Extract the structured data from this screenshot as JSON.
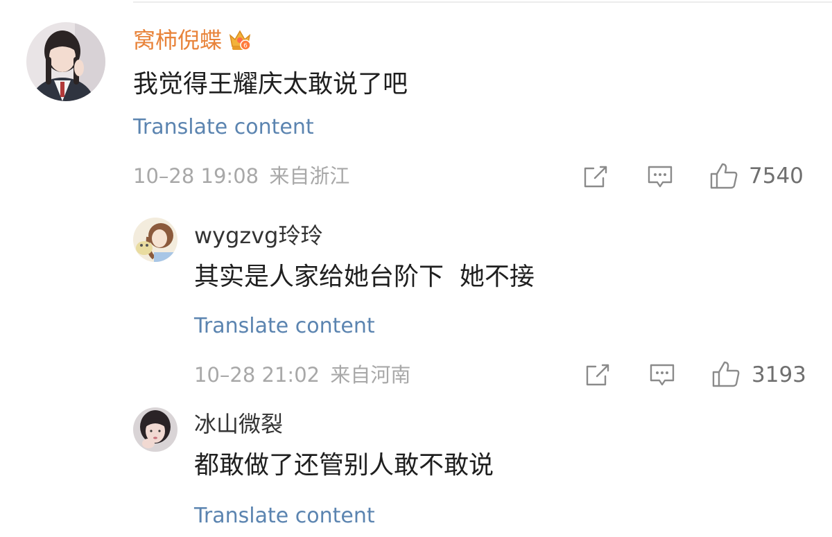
{
  "comments": [
    {
      "username": "窝柿倪蝶",
      "vip_badge_icon": "crown-badge-icon",
      "text": "我觉得王耀庆太敢说了吧",
      "translate_label": "Translate content",
      "timestamp": "10–28 19:08",
      "location": "来自浙江",
      "like_count": "7540"
    }
  ],
  "replies": [
    {
      "username": "wygzvg玲玲",
      "text": "其实是人家给她台阶下  她不接",
      "translate_label": "Translate content",
      "timestamp": "10–28 21:02",
      "location": "来自河南",
      "like_count": "3193"
    },
    {
      "username": "冰山微裂",
      "text": "都敢做了还管别人敢不敢说",
      "translate_label": "Translate content"
    }
  ],
  "colors": {
    "vip_username": "#e8833a",
    "username": "#333333",
    "translate_link": "#5b84b0",
    "meta_text": "#a8a8a8",
    "icon_stroke": "#8a8a8a"
  },
  "icons": [
    "share-icon",
    "comment-icon",
    "like-icon"
  ]
}
